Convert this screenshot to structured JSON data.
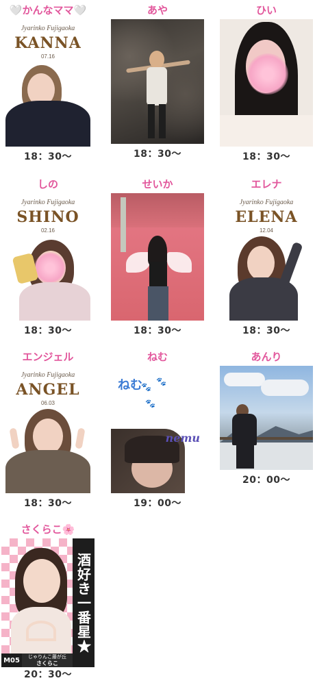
{
  "cards": [
    {
      "name": "🤍かんなママ🤍",
      "time": "18：30〜",
      "brand": "Jyarinko Fujigaoka",
      "profile_name": "KANNA",
      "profile_date": "07.16"
    },
    {
      "name": "あや",
      "time": "18：30〜"
    },
    {
      "name": "ひい",
      "time": "18：30〜"
    },
    {
      "name": "しの",
      "time": "18：30〜",
      "brand": "Jyarinko Fujigaoka",
      "profile_name": "SHINO",
      "profile_date": "02.16"
    },
    {
      "name": "せいか",
      "time": "18：30〜"
    },
    {
      "name": "エレナ",
      "time": "18：30〜",
      "brand": "Jyarinko Fujigaoka",
      "profile_name": "ELENA",
      "profile_date": "12.04"
    },
    {
      "name": "エンジェル",
      "time": "18：30〜",
      "brand": "Jyarinko Fujigaoka",
      "profile_name": "ANGEL",
      "profile_date": "06.03"
    },
    {
      "name": "ねむ",
      "time": "19：00〜",
      "photo_text": "ねむ",
      "photo_sign": "nemu"
    },
    {
      "name": "あんり",
      "time": "20：00〜"
    },
    {
      "name": "さくらこ🌸",
      "time": "20：30〜",
      "banner_text": "酒好き一番星★",
      "badge_num": "M05",
      "badge_sub": "じゃりんこ藤が丘",
      "badge_name": "さくらこ"
    }
  ],
  "colors": {
    "name_pink": "#e2579c",
    "time_text": "#333333"
  }
}
